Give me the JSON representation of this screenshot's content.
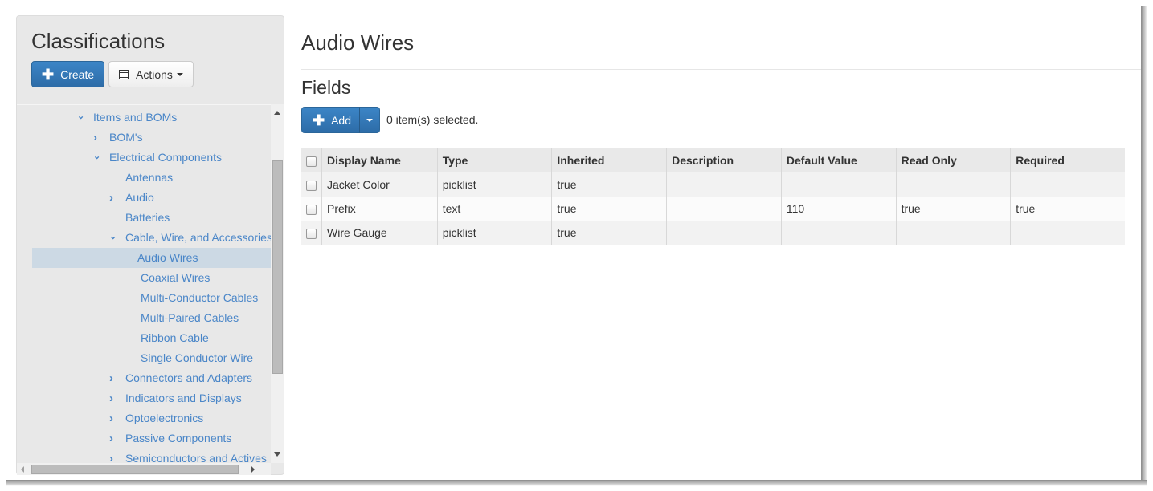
{
  "sidebar": {
    "title": "Classifications",
    "create_label": "Create",
    "actions_label": "Actions",
    "tree": [
      {
        "label": "Items and BOMs",
        "level": 0,
        "toggle": "expanded"
      },
      {
        "label": "BOM's",
        "level": 1,
        "toggle": "collapsed"
      },
      {
        "label": "Electrical Components",
        "level": 1,
        "toggle": "expanded"
      },
      {
        "label": "Antennas",
        "level": 2,
        "toggle": "none"
      },
      {
        "label": "Audio",
        "level": 2,
        "toggle": "collapsed"
      },
      {
        "label": "Batteries",
        "level": 2,
        "toggle": "none"
      },
      {
        "label": "Cable, Wire, and Accessories",
        "level": 2,
        "toggle": "expanded"
      },
      {
        "label": "Audio Wires",
        "level": 3,
        "toggle": "none",
        "selected": true
      },
      {
        "label": "Coaxial Wires",
        "level": 3,
        "toggle": "none"
      },
      {
        "label": "Multi-Conductor Cables",
        "level": 3,
        "toggle": "none"
      },
      {
        "label": "Multi-Paired Cables",
        "level": 3,
        "toggle": "none"
      },
      {
        "label": "Ribbon Cable",
        "level": 3,
        "toggle": "none"
      },
      {
        "label": "Single Conductor Wire",
        "level": 3,
        "toggle": "none"
      },
      {
        "label": "Connectors and Adapters",
        "level": 2,
        "toggle": "collapsed"
      },
      {
        "label": "Indicators and Displays",
        "level": 2,
        "toggle": "collapsed"
      },
      {
        "label": "Optoelectronics",
        "level": 2,
        "toggle": "collapsed"
      },
      {
        "label": "Passive Components",
        "level": 2,
        "toggle": "collapsed"
      },
      {
        "label": "Semiconductors and Actives",
        "level": 2,
        "toggle": "collapsed"
      }
    ]
  },
  "main": {
    "title": "Audio Wires",
    "section_title": "Fields",
    "add_label": "Add",
    "selection_status": "0 item(s) selected.",
    "table": {
      "columns": [
        "Display Name",
        "Type",
        "Inherited",
        "Description",
        "Default Value",
        "Read Only",
        "Required"
      ],
      "rows": [
        [
          "Jacket Color",
          "picklist",
          "true",
          "",
          "",
          "",
          ""
        ],
        [
          "Prefix",
          "text",
          "true",
          "",
          "110",
          "true",
          "true"
        ],
        [
          "Wire Gauge",
          "picklist",
          "true",
          "",
          "",
          "",
          ""
        ]
      ]
    }
  }
}
